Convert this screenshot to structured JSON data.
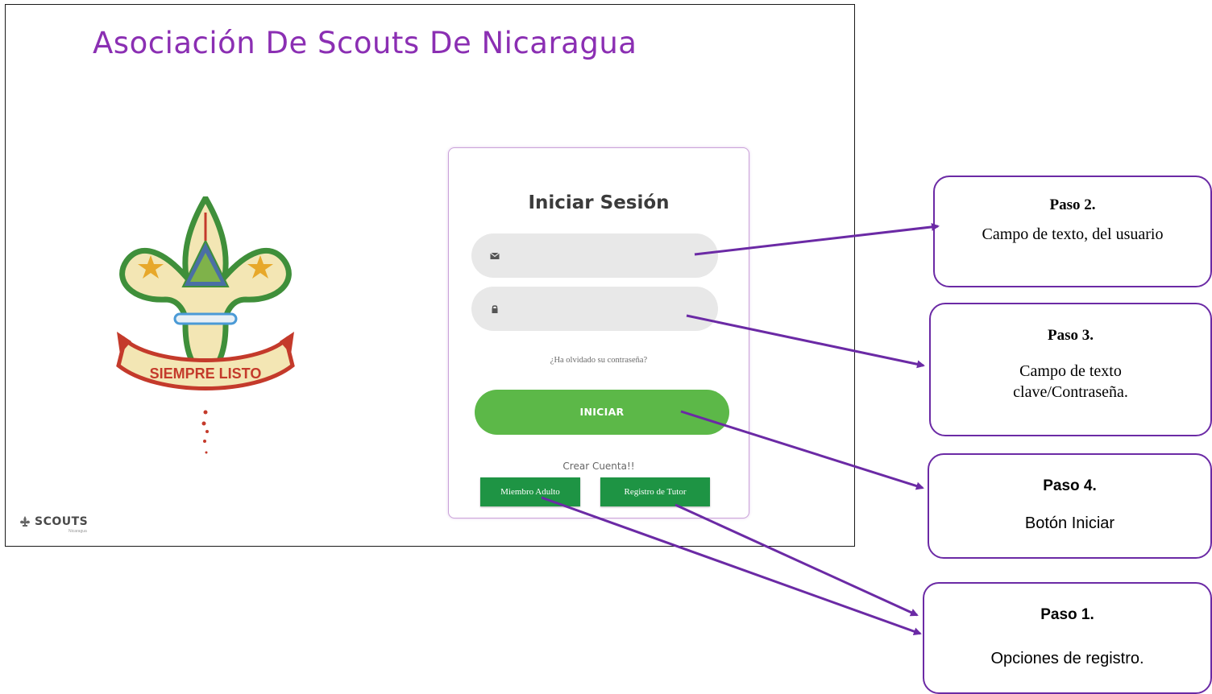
{
  "site": {
    "title": "Asociación De Scouts De Nicaragua",
    "emblem_banner": "SIEMPRE LISTO",
    "footer_brand": "SCOUTS",
    "footer_sub": "Nicaragua"
  },
  "login": {
    "title": "Iniciar Sesión",
    "email_placeholder": "",
    "password_placeholder": "",
    "forgot_password": "¿Ha olvidado su contraseña?",
    "submit_label": "INICIAR",
    "create_account": "Crear Cuenta!!",
    "register_adult": "Miembro Adulto",
    "register_tutor": "Registro de Tutor"
  },
  "icons": {
    "email": "envelope-icon",
    "password": "lock-icon",
    "footer": "fleur-de-lis-icon"
  },
  "colors": {
    "brand_purple": "#8b2fb3",
    "primary_green": "#5cb848",
    "register_green": "#1e9444",
    "callout_border": "#6b2aa5"
  },
  "callouts": [
    {
      "id": "paso2",
      "title": "Paso 2.",
      "body": "Campo de texto, del usuario"
    },
    {
      "id": "paso3",
      "title": "Paso 3.",
      "body": "Campo de texto clave/Contraseña."
    },
    {
      "id": "paso4",
      "title": "Paso 4.",
      "body": "Botón Iniciar"
    },
    {
      "id": "paso1",
      "title": "Paso 1.",
      "body": "Opciones de registro."
    }
  ]
}
